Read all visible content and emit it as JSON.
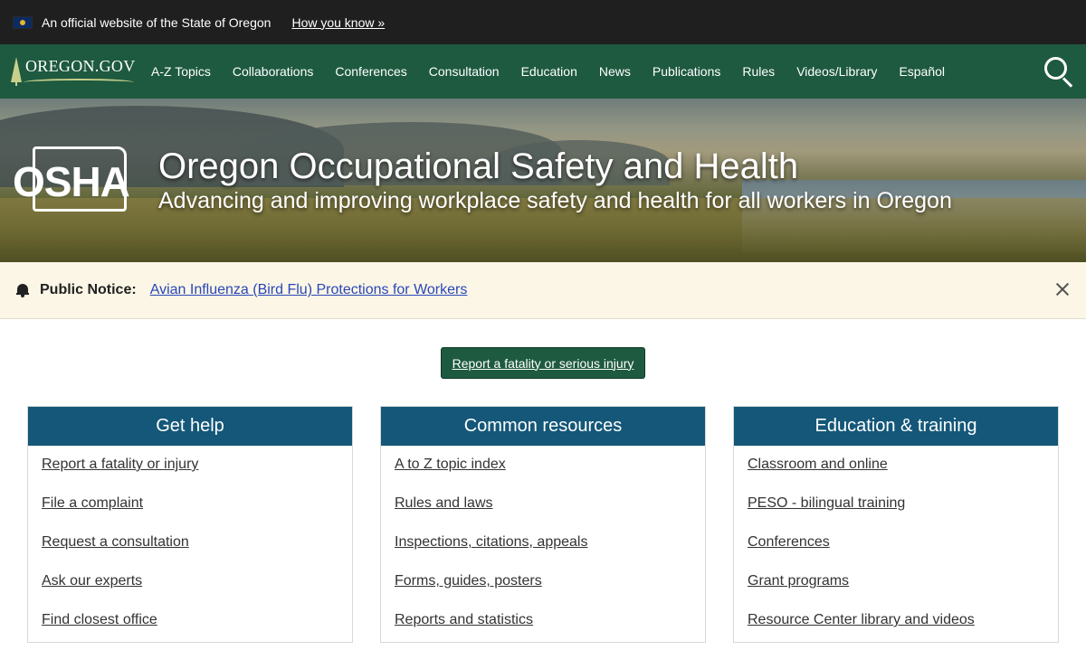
{
  "official_banner": {
    "text": "An official website of the State of Oregon",
    "link": "How you know »"
  },
  "nav": {
    "logo": "OREGON.GOV",
    "items": [
      "A-Z Topics",
      "Collaborations",
      "Conferences",
      "Consultation",
      "Education",
      "News",
      "Publications",
      "Rules",
      "Videos/Library",
      "Español"
    ]
  },
  "hero": {
    "logo_text": "OSHA",
    "title": "Oregon Occupational Safety and Health",
    "subtitle": "Advancing and improving workplace safety and health for all workers in Oregon"
  },
  "notice": {
    "label": "Public Notice:",
    "link": "Avian Influenza (Bird Flu) Protections for Workers"
  },
  "report_button": "Report a fatality or serious injury",
  "cards": [
    {
      "title": "Get help",
      "links": [
        "Report a fatality or injury",
        "File a complaint",
        "Request a consultation",
        "Ask our experts",
        "Find closest office"
      ]
    },
    {
      "title": "Common resources",
      "links": [
        "A to Z topic index",
        "Rules and laws",
        "Inspections, citations, appeals",
        "Forms, guides, posters",
        "Reports and statistics"
      ]
    },
    {
      "title": "Education & training",
      "links": [
        "Classroom and online",
        "PESO - bilingual training",
        "Conferences",
        "Grant programs",
        "Resource Center library and videos"
      ]
    }
  ],
  "colors": {
    "top_bar": "#1f1f1f",
    "nav": "#1e5a40",
    "card_header": "#145778",
    "notice_bg": "#fbf6e6",
    "notice_link": "#2a47b8"
  }
}
